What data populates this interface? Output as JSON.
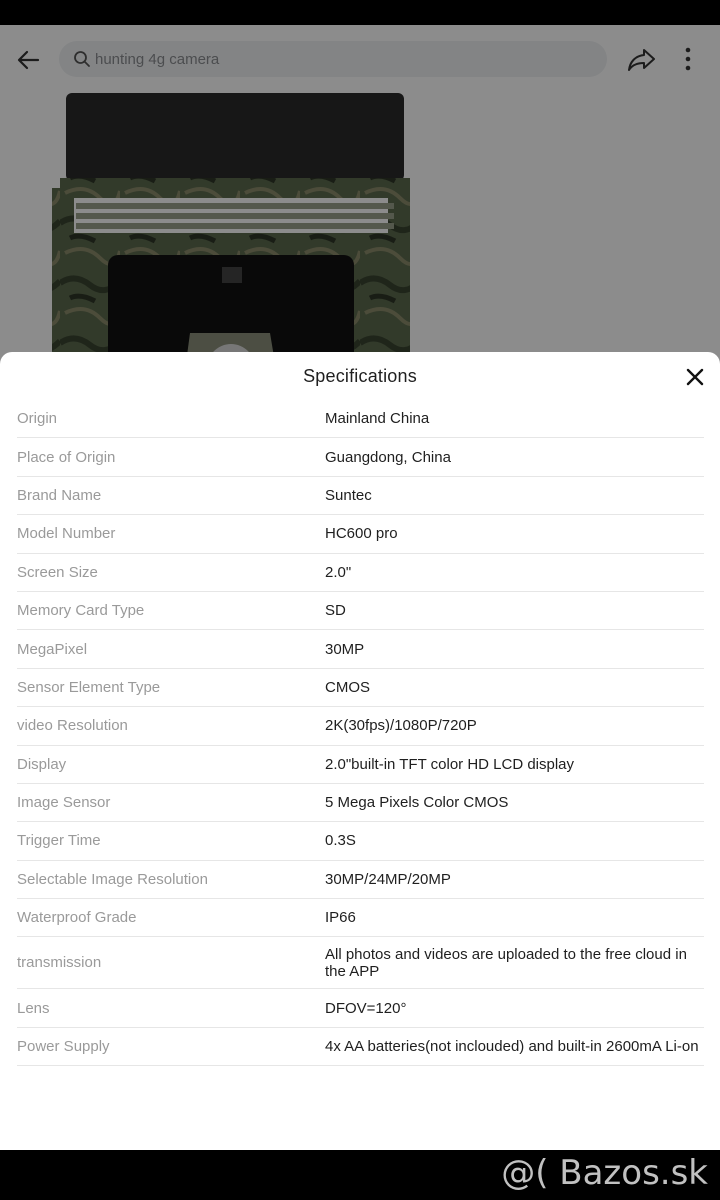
{
  "search": {
    "placeholder": "hunting 4g camera"
  },
  "icons": {
    "back": "arrow-left-icon",
    "search": "search-icon",
    "share": "share-icon",
    "more": "more-vertical-icon",
    "close": "close-icon"
  },
  "sheet": {
    "title": "Specifications",
    "rows": [
      {
        "label": "Origin",
        "value": "Mainland China"
      },
      {
        "label": "Place of Origin",
        "value": "Guangdong, China"
      },
      {
        "label": "Brand Name",
        "value": "Suntec"
      },
      {
        "label": "Model Number",
        "value": "HC600 pro"
      },
      {
        "label": "Screen Size",
        "value": "2.0\""
      },
      {
        "label": "Memory Card Type",
        "value": "SD"
      },
      {
        "label": "MegaPixel",
        "value": "30MP"
      },
      {
        "label": "Sensor Element Type",
        "value": "CMOS"
      },
      {
        "label": "video Resolution",
        "value": "2K(30fps)/1080P/720P"
      },
      {
        "label": "Display",
        "value": "2.0\"built-in TFT color HD LCD display"
      },
      {
        "label": "Image Sensor",
        "value": "5 Mega Pixels Color CMOS"
      },
      {
        "label": "Trigger Time",
        "value": "0.3S"
      },
      {
        "label": "Selectable Image Resolution",
        "value": "30MP/24MP/20MP"
      },
      {
        "label": "Waterproof Grade",
        "value": "IP66"
      },
      {
        "label": "transmission",
        "value": "All photos and videos are uploaded to the free cloud in the APP"
      },
      {
        "label": "Lens",
        "value": "DFOV=120°"
      },
      {
        "label": "Power Supply",
        "value": "4x AA batteries(not inclouded) and built-in 2600mA Li-on"
      }
    ]
  },
  "watermark": "@( Bazos.sk"
}
